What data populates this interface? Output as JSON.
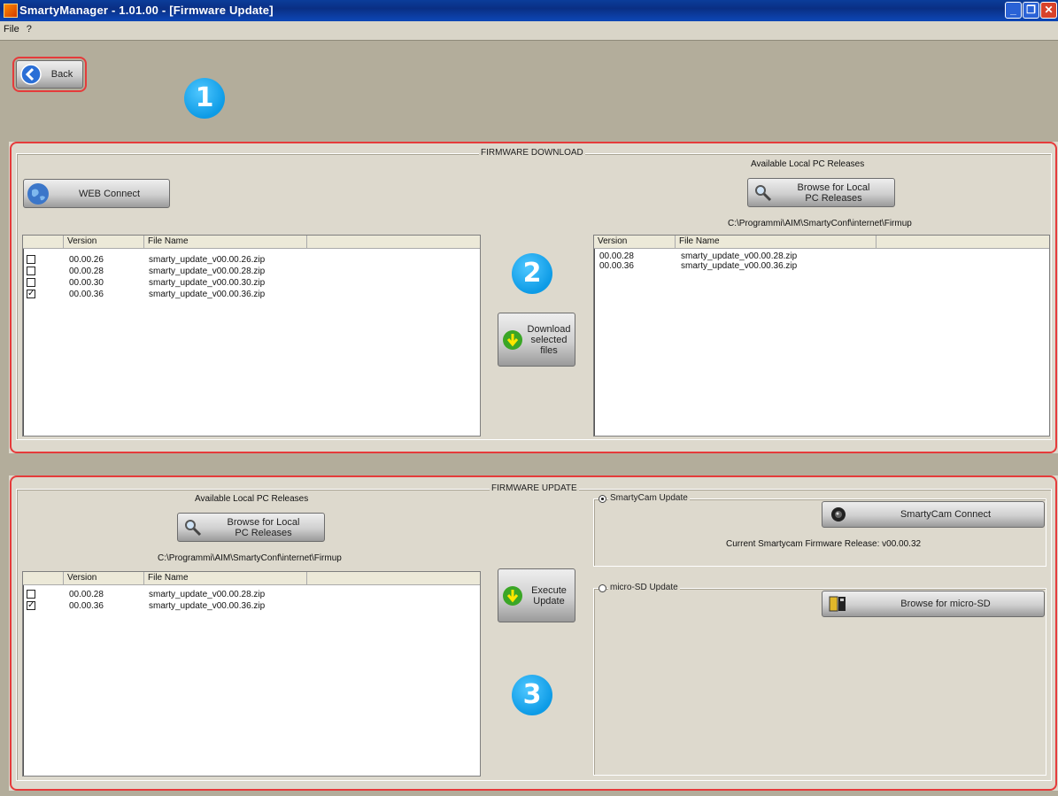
{
  "window": {
    "title": "SmartyManager - 1.01.00 - [Firmware Update]"
  },
  "menu": [
    "File",
    "?"
  ],
  "toolbar": {
    "back_label": "Back"
  },
  "badges": [
    "1",
    "2",
    "3"
  ],
  "download": {
    "group_title": "FIRMWARE  DOWNLOAD",
    "web_connect_label": "WEB  Connect",
    "web_list": {
      "columns": [
        "Version",
        "File Name"
      ],
      "rows": [
        {
          "version": "00.00.26",
          "file": "smarty_update_v00.00.26.zip",
          "checked": false
        },
        {
          "version": "00.00.28",
          "file": "smarty_update_v00.00.28.zip",
          "checked": false
        },
        {
          "version": "00.00.30",
          "file": "smarty_update_v00.00.30.zip",
          "checked": false
        },
        {
          "version": "00.00.36",
          "file": "smarty_update_v00.00.36.zip",
          "checked": true
        }
      ]
    },
    "download_button_label": "Download selected files",
    "local_title": "Available Local PC Releases",
    "browse_label": "Browse for Local PC Releases",
    "local_path": "C:\\Programmi\\AIM\\SmartyConf\\internet\\Firmup",
    "local_list": {
      "columns": [
        "Version",
        "File Name"
      ],
      "rows": [
        {
          "version": "00.00.28",
          "file": "smarty_update_v00.00.28.zip"
        },
        {
          "version": "00.00.36",
          "file": "smarty_update_v00.00.36.zip"
        }
      ]
    }
  },
  "update": {
    "group_title": "FIRMWARE  UPDATE",
    "local_title": "Available Local PC Releases",
    "browse_label": "Browse for Local PC Releases",
    "local_path": "C:\\Programmi\\AIM\\SmartyConf\\internet\\Firmup",
    "list": {
      "columns": [
        "Version",
        "File Name"
      ],
      "rows": [
        {
          "version": "00.00.28",
          "file": "smarty_update_v00.00.28.zip",
          "checked": false
        },
        {
          "version": "00.00.36",
          "file": "smarty_update_v00.00.36.zip",
          "checked": true
        }
      ]
    },
    "execute_label": "Execute Update",
    "smartycam_radio_label": "SmartyCam Update",
    "smartycam_connect_label": "SmartyCam  Connect",
    "current_release": "Current Smartycam Firmware Release: v00.00.32",
    "microsd_radio_label": "micro-SD Update",
    "browse_microsd_label": "Browse for micro-SD"
  }
}
